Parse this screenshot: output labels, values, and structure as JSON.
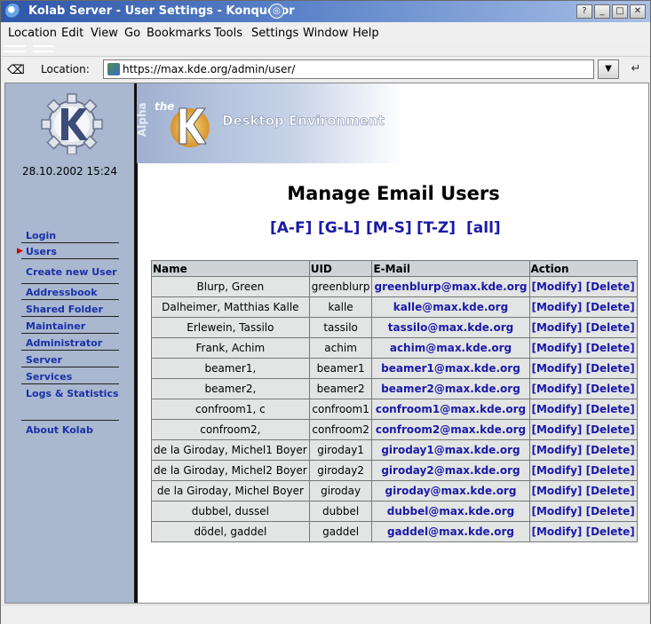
{
  "window": {
    "title": "Kolab Server - User Settings - Konqueror",
    "buttons": [
      "?",
      "_",
      "□",
      "✕"
    ]
  },
  "menu": [
    "Location",
    "Edit",
    "View",
    "Go",
    "Bookmarks",
    "Tools",
    "Settings",
    "Window",
    "Help"
  ],
  "location": {
    "label": "Location:",
    "url": "https://max.kde.org/admin/user/"
  },
  "sidebar": {
    "datetime": "28.10.2002 15:24",
    "items": [
      {
        "label": "Login",
        "active": false
      },
      {
        "label": "Users",
        "active": true
      },
      {
        "label": "Create new User",
        "active": false
      },
      {
        "label": "Addressbook",
        "active": false
      },
      {
        "label": "Shared Folder",
        "active": false
      },
      {
        "label": "Maintainer",
        "active": false
      },
      {
        "label": "Administrator",
        "active": false
      },
      {
        "label": "Server",
        "active": false
      },
      {
        "label": "Services",
        "active": false
      },
      {
        "label": "Logs & Statistics",
        "active": false
      },
      {
        "label": "About Kolab",
        "active": false
      }
    ]
  },
  "banner": {
    "alpha": "Alpha",
    "the": "the",
    "text": "Desktop Environment"
  },
  "main": {
    "heading": "Manage Email Users",
    "filters": [
      "[A-F]",
      "[G-L]",
      "[M-S]",
      "[T-Z]",
      "[all]"
    ],
    "columns": [
      "Name",
      "UID",
      "E-Mail",
      "Action"
    ],
    "modify_label": "[Modify]",
    "delete_label": "[Delete]",
    "rows": [
      {
        "name": "Blurp, Green",
        "uid": "greenblurp",
        "email": "greenblurp@max.kde.org"
      },
      {
        "name": "Dalheimer, Matthias Kalle",
        "uid": "kalle",
        "email": "kalle@max.kde.org"
      },
      {
        "name": "Erlewein, Tassilo",
        "uid": "tassilo",
        "email": "tassilo@max.kde.org"
      },
      {
        "name": "Frank, Achim",
        "uid": "achim",
        "email": "achim@max.kde.org"
      },
      {
        "name": "beamer1,",
        "uid": "beamer1",
        "email": "beamer1@max.kde.org"
      },
      {
        "name": "beamer2,",
        "uid": "beamer2",
        "email": "beamer2@max.kde.org"
      },
      {
        "name": "confroom1, c",
        "uid": "confroom1",
        "email": "confroom1@max.kde.org"
      },
      {
        "name": "confroom2,",
        "uid": "confroom2",
        "email": "confroom2@max.kde.org"
      },
      {
        "name": "de la Giroday, Michel1 Boyer",
        "uid": "giroday1",
        "email": "giroday1@max.kde.org"
      },
      {
        "name": "de la Giroday, Michel2 Boyer",
        "uid": "giroday2",
        "email": "giroday2@max.kde.org"
      },
      {
        "name": "de la Giroday, Michel Boyer",
        "uid": "giroday",
        "email": "giroday@max.kde.org"
      },
      {
        "name": "dubbel, dussel",
        "uid": "dubbel",
        "email": "dubbel@max.kde.org"
      },
      {
        "name": "dödel, gaddel",
        "uid": "gaddel",
        "email": "gaddel@max.kde.org"
      }
    ]
  },
  "colors": {
    "titlebar": "#2f56a8",
    "sidebar": "#a9b7cf",
    "link": "#1a1aa8",
    "active_marker": "#cc0000"
  }
}
